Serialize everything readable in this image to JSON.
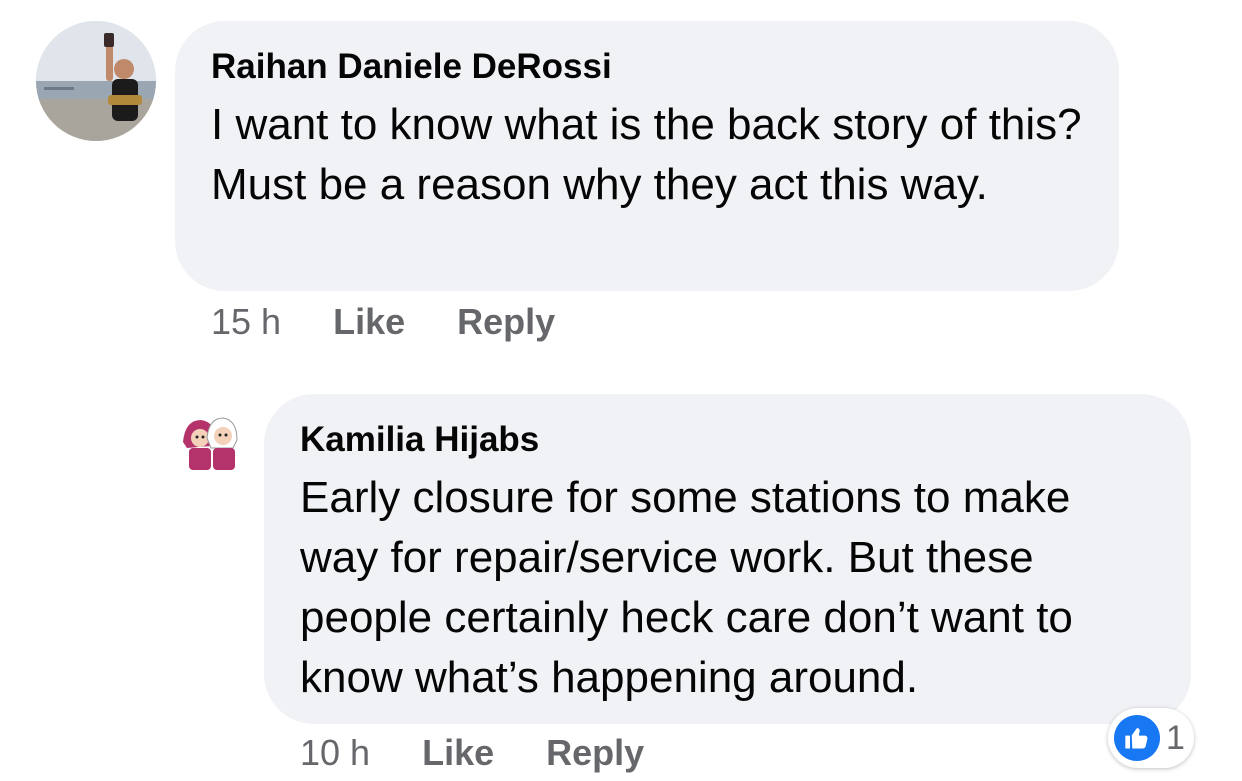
{
  "comments": [
    {
      "author": "Raihan Daniele DeRossi",
      "text": "I want to know what is the back story of this? Must be a reason why they act this way.",
      "time": "15 h",
      "like_label": "Like",
      "reply_label": "Reply"
    },
    {
      "author": "Kamilia Hijabs",
      "text": "Early closure for some stations to make way for repair/service work. But these people certainly heck care don’t want to know what’s happening around.",
      "time": "10 h",
      "like_label": "Like",
      "reply_label": "Reply",
      "reaction_icon": "thumbs-up-icon",
      "reaction_count": "1"
    }
  ],
  "colors": {
    "bubble": "#f0f2f5",
    "meta_text": "#65676b",
    "like_blue": "#1877f2"
  }
}
